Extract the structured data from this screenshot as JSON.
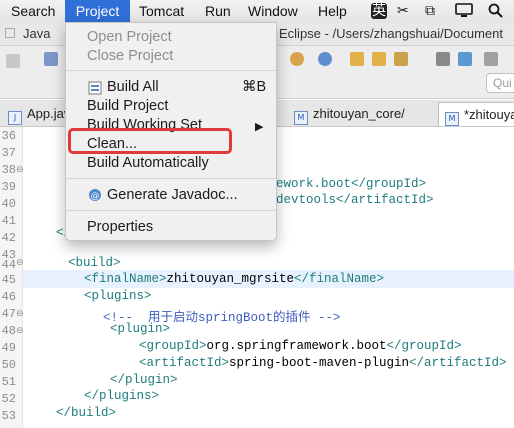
{
  "menubar": {
    "items": [
      "Search",
      "Project",
      "Tomcat",
      "Run",
      "Window",
      "Help"
    ],
    "active": "Project",
    "status": {
      "input_method": "英"
    }
  },
  "window": {
    "title_left": "Java",
    "title_right": "Eclipse - /Users/zhangshuai/Document"
  },
  "toolbar": {
    "quick_access_placeholder": "Qui"
  },
  "tabs": [
    {
      "label": "App.java"
    },
    {
      "label": "zhitouyan_core/"
    },
    {
      "label": "*zhitouyan"
    }
  ],
  "project_menu": {
    "items": [
      {
        "label": "Open Project",
        "enabled": false
      },
      {
        "label": "Close Project",
        "enabled": false
      },
      {
        "label": "Build All",
        "shortcut": "⌘B",
        "enabled": true
      },
      {
        "label": "Build Project",
        "enabled": true
      },
      {
        "label": "Build Working Set",
        "enabled": true,
        "submenu": true
      },
      {
        "label": "Clean...",
        "enabled": true,
        "highlighted_box": true
      },
      {
        "label": "Build Automatically",
        "enabled": true
      },
      {
        "label": "Generate Javadoc...",
        "enabled": true
      },
      {
        "label": "Properties",
        "enabled": true
      }
    ]
  },
  "editor": {
    "line_numbers": [
      "36",
      "37",
      "38",
      "39",
      "40",
      "41",
      "42",
      "43",
      "44",
      "45",
      "46",
      "47",
      "48",
      "49",
      "50",
      "51",
      "52",
      "53"
    ],
    "visible_code_fragments": {
      "l39": "ework.boot</groupId>",
      "l40": "devtools</artifactId>",
      "l42": "</",
      "l44": "<build>",
      "l45_open": "<finalName>",
      "l45_text": "zhitouyan_mgrsite",
      "l45_close": "</finalName>",
      "l46": "<plugins>",
      "l47": "<!--  用于启动springBoot的插件 -->",
      "l48": "<plugin>",
      "l49_open": "<groupId>",
      "l49_text": "org.springframework.boot",
      "l49_close": "</groupId>",
      "l50_open": "<artifactId>",
      "l50_text": "spring-boot-maven-plugin",
      "l50_close": "</artifactId>",
      "l51": "</plugin>",
      "l52": "</plugins>",
      "l53": "</build>"
    }
  }
}
